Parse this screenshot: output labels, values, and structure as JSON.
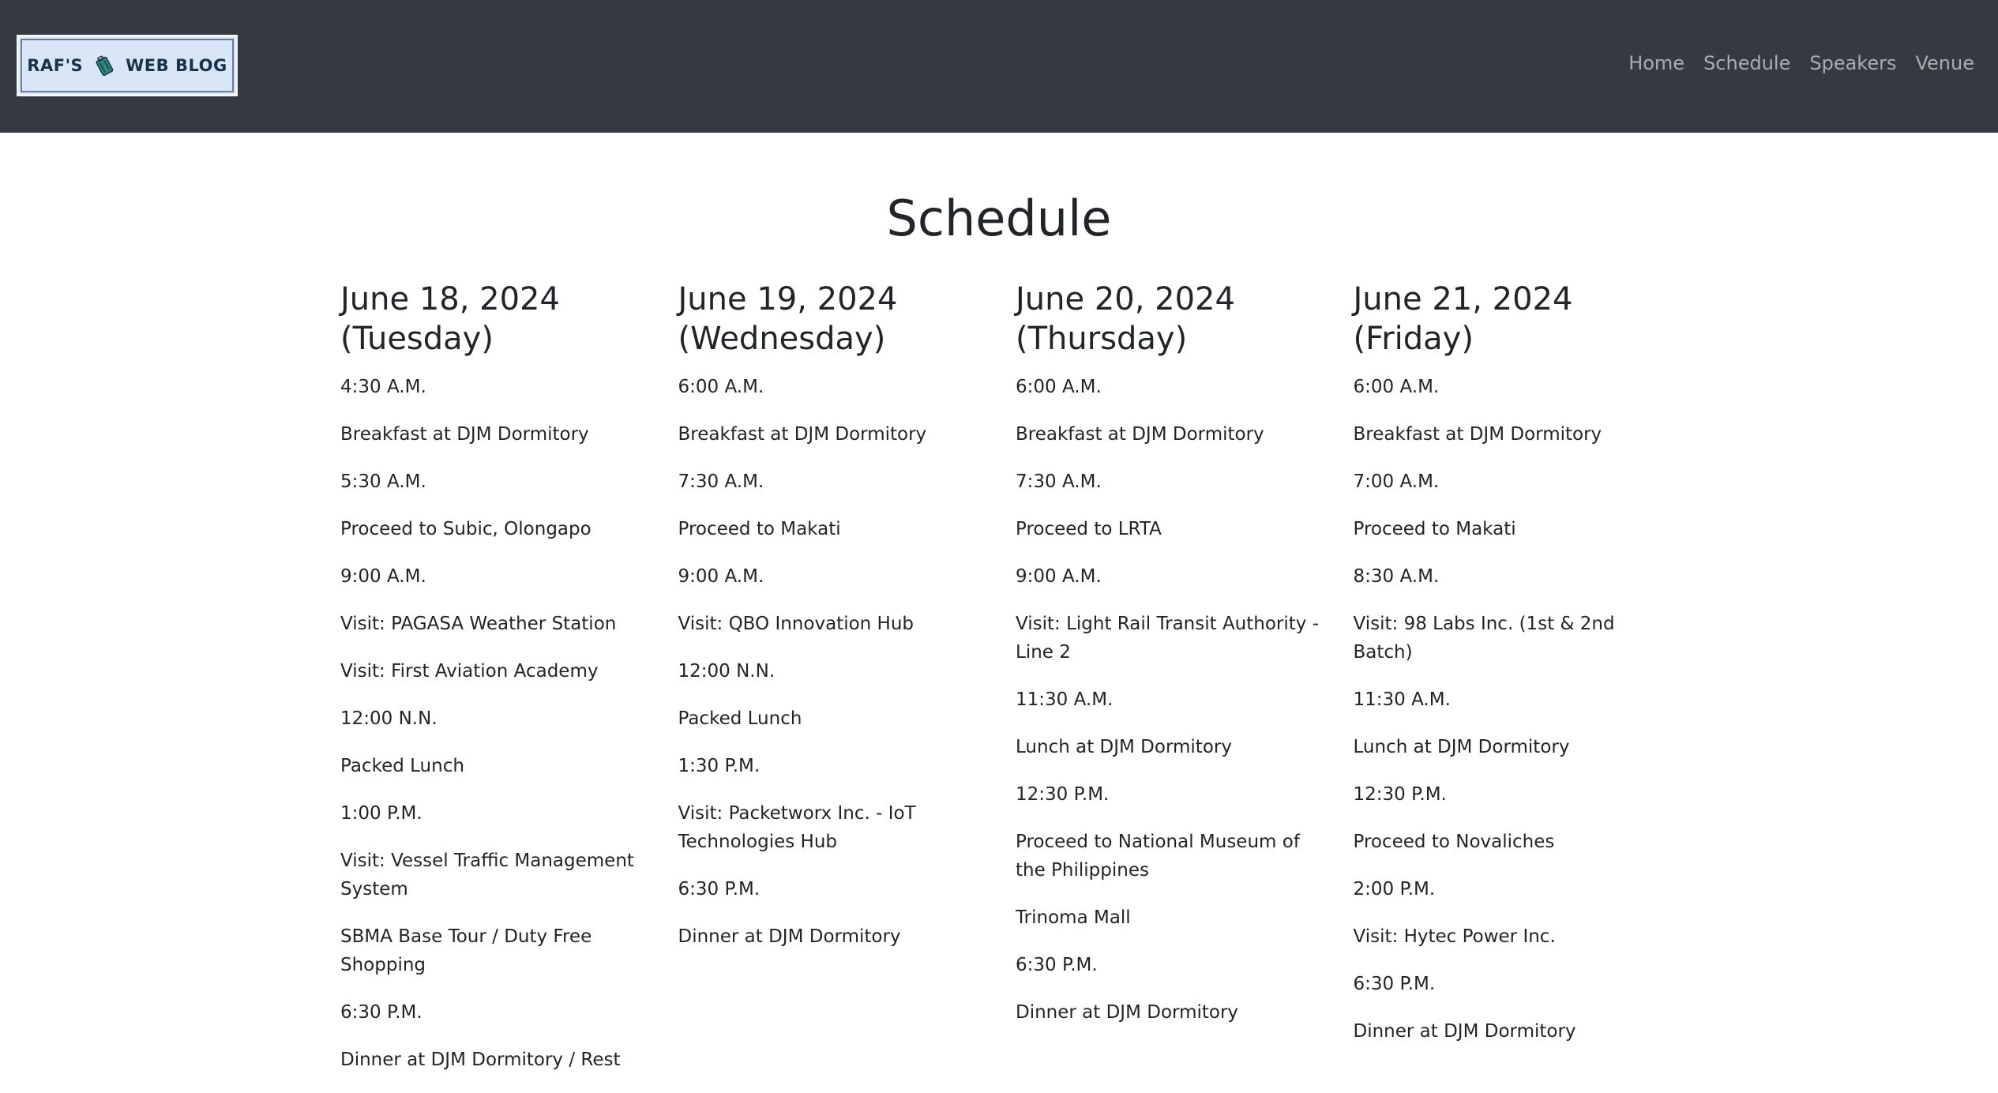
{
  "nav": {
    "brand_left": "RAF'S",
    "brand_right": "WEB BLOG",
    "links": [
      "Home",
      "Schedule",
      "Speakers",
      "Venue"
    ]
  },
  "page": {
    "title": "Schedule"
  },
  "days": [
    {
      "title": "June 18, 2024 (Tuesday)",
      "entries": [
        "4:30 A.M.",
        "Breakfast at DJM Dormitory",
        "5:30 A.M.",
        "Proceed to Subic, Olongapo",
        "9:00 A.M.",
        "Visit: PAGASA Weather Station",
        "Visit: First Aviation Academy",
        "12:00 N.N.",
        "Packed Lunch",
        "1:00 P.M.",
        "Visit: Vessel Traffic Management System",
        "SBMA Base Tour / Duty Free Shopping",
        "6:30 P.M.",
        "Dinner at DJM Dormitory / Rest"
      ]
    },
    {
      "title": "June 19, 2024 (Wednesday)",
      "entries": [
        "6:00 A.M.",
        "Breakfast at DJM Dormitory",
        "7:30 A.M.",
        "Proceed to Makati",
        "9:00 A.M.",
        "Visit: QBO Innovation Hub",
        "12:00 N.N.",
        "Packed Lunch",
        "1:30 P.M.",
        "Visit: Packetworx Inc. - IoT Technologies Hub",
        "6:30 P.M.",
        "Dinner at DJM Dormitory"
      ]
    },
    {
      "title": "June 20, 2024 (Thursday)",
      "entries": [
        "6:00 A.M.",
        "Breakfast at DJM Dormitory",
        "7:30 A.M.",
        "Proceed to LRTA",
        "9:00 A.M.",
        "Visit: Light Rail Transit Authority - Line 2",
        "11:30 A.M.",
        "Lunch at DJM Dormitory",
        "12:30 P.M.",
        "Proceed to National Museum of the Philippines",
        "Trinoma Mall",
        "6:30 P.M.",
        "Dinner at DJM Dormitory"
      ]
    },
    {
      "title": "June 21, 2024 (Friday)",
      "entries": [
        "6:00 A.M.",
        "Breakfast at DJM Dormitory",
        "7:00 A.M.",
        "Proceed to Makati",
        "8:30 A.M.",
        "Visit: 98 Labs Inc. (1st & 2nd Batch)",
        "11:30 A.M.",
        "Lunch at DJM Dormitory",
        "12:30 P.M.",
        "Proceed to Novaliches",
        "2:00 P.M.",
        "Visit: Hytec Power Inc.",
        "6:30 P.M.",
        "Dinner at DJM Dormitory"
      ]
    }
  ]
}
